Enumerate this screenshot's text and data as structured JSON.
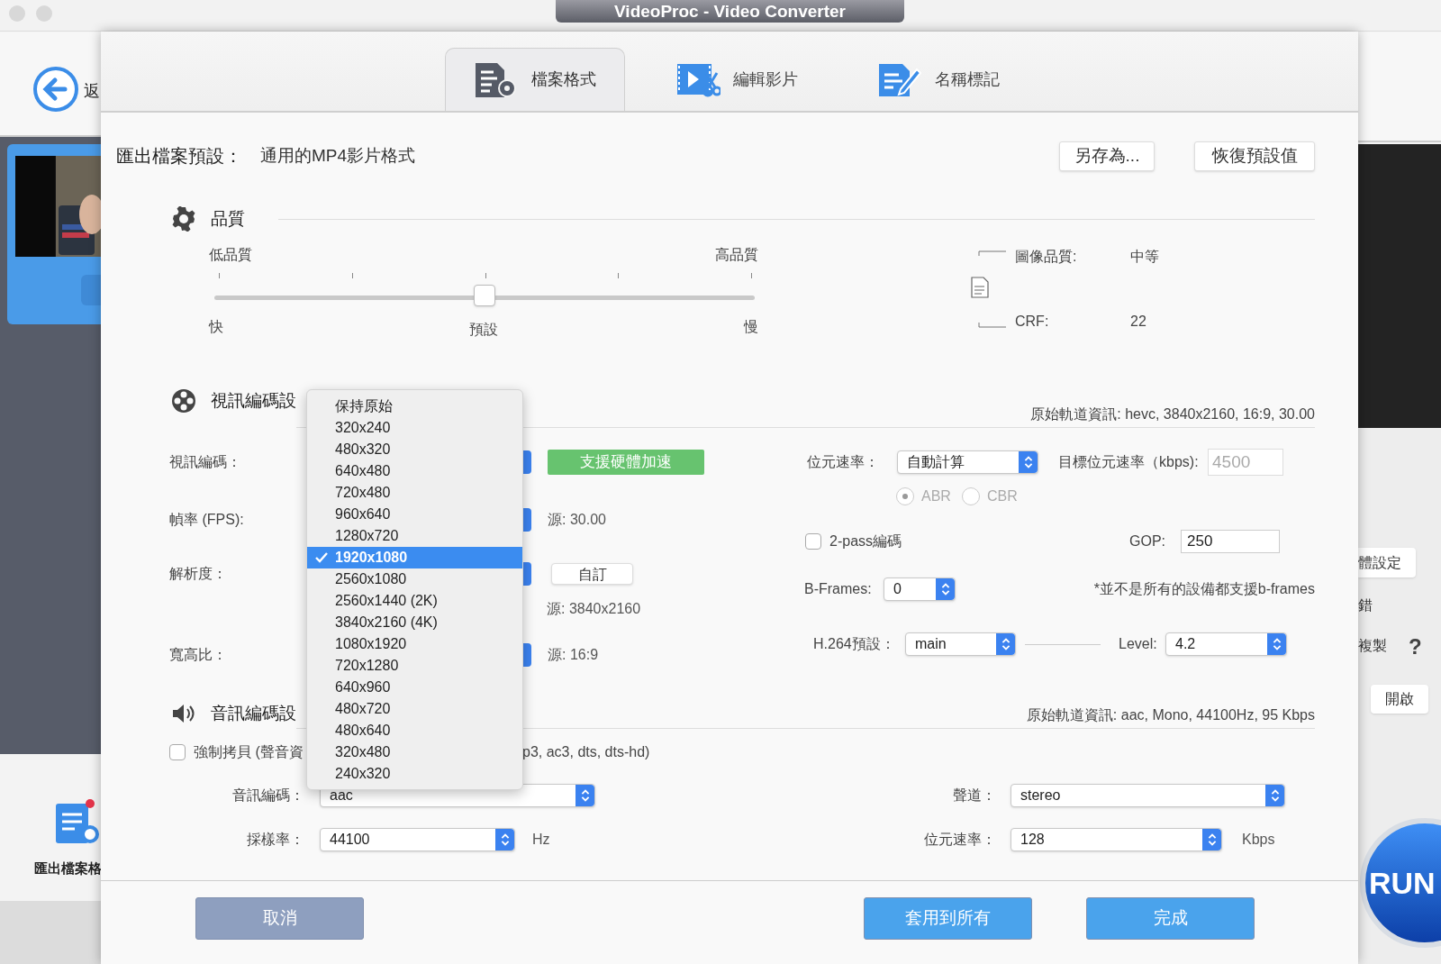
{
  "window": {
    "title": "VideoProc - Video Converter"
  },
  "background_app": {
    "back_label": "返",
    "export_label": "匯出檔案格",
    "right_items": [
      "體設定",
      "錯",
      "複製"
    ],
    "help": "?",
    "open_button": "開啟",
    "run_button": "RUN"
  },
  "tabs": [
    {
      "label": "檔案格式",
      "selected": true,
      "kind": "format"
    },
    {
      "label": "編輯影片",
      "selected": false,
      "kind": "edit"
    },
    {
      "label": "名稱標記",
      "selected": false,
      "kind": "tag"
    }
  ],
  "preset": {
    "label": "匯出檔案預設：",
    "value": "通用的MP4影片格式",
    "buttons": [
      "另存為...",
      "恢復預設值"
    ]
  },
  "quality": {
    "title": "品質",
    "low_label": "低品質",
    "high_label": "高品質",
    "fast_label": "快",
    "default_label": "預設",
    "slow_label": "慢",
    "level": 0.5,
    "image_quality_label": "圖像品質:",
    "image_quality_value": "中等",
    "crf_label": "CRF:",
    "crf_value": "22"
  },
  "video": {
    "title": "視訊編碼設",
    "source_info": "原始軌道資訊: hevc, 3840x2160, 16:9, 30.00",
    "codec_label": "視訊編碼：",
    "hw_badge": "支援硬體加速",
    "fps_label": "幀率 (FPS):",
    "fps_source": "源: 30.00",
    "resolution_label": "解析度：",
    "custom_button": "自訂",
    "resolution_source": "源: 3840x2160",
    "aspect_label": "寬高比：",
    "aspect_source": "源: 16:9",
    "bitrate_label": "位元速率：",
    "bitrate_mode": "自動計算",
    "target_label": "目標位元速率（kbps):",
    "target_value": "4500",
    "target_disabled": true,
    "rate_modes": [
      {
        "label": "ABR",
        "selected": true
      },
      {
        "label": "CBR",
        "selected": false
      }
    ],
    "rate_modes_disabled": true,
    "two_pass": {
      "label": "2-pass編碼",
      "checked": false
    },
    "gop_label": "GOP:",
    "gop_value": "250",
    "bframes_label": "B-Frames:",
    "bframes_value": "0",
    "bframes_note": "*並不是所有的設備都支援b-frames",
    "h264_label": "H.264預設：",
    "h264_value": "main",
    "level_label": "Level:",
    "level_value": "4.2"
  },
  "audio": {
    "title": "音訊編碼設",
    "source_info": "原始軌道資訊: aac, Mono, 44100Hz, 95 Kbps",
    "force_copy": {
      "label": "強制拷貝 (聲音資",
      "checked": false
    },
    "force_copy_tail": "p3, ac3, dts, dts-hd)",
    "codec_label": "音訊編碼：",
    "codec_value": "aac",
    "sample_label": "採樣率：",
    "sample_value": "44100",
    "sample_unit": "Hz",
    "channel_label": "聲道：",
    "channel_value": "stereo",
    "bitrate_label": "位元速率：",
    "bitrate_value": "128",
    "bitrate_unit": "Kbps"
  },
  "resolution_menu": {
    "items": [
      {
        "label": "保持原始",
        "selected": false
      },
      {
        "label": "320x240",
        "selected": false
      },
      {
        "label": "480x320",
        "selected": false
      },
      {
        "label": "640x480",
        "selected": false
      },
      {
        "label": "720x480",
        "selected": false
      },
      {
        "label": "960x640",
        "selected": false
      },
      {
        "label": "1280x720",
        "selected": false
      },
      {
        "label": "1920x1080",
        "selected": true
      },
      {
        "label": "2560x1080",
        "selected": false
      },
      {
        "label": "2560x1440 (2K)",
        "selected": false
      },
      {
        "label": "3840x2160 (4K)",
        "selected": false
      },
      {
        "label": "1080x1920",
        "selected": false
      },
      {
        "label": "720x1280",
        "selected": false
      },
      {
        "label": "640x960",
        "selected": false
      },
      {
        "label": "480x720",
        "selected": false
      },
      {
        "label": "480x640",
        "selected": false
      },
      {
        "label": "320x480",
        "selected": false
      },
      {
        "label": "240x320",
        "selected": false
      }
    ]
  },
  "footer": {
    "buttons": [
      {
        "label": "取消",
        "kind": "secondary"
      },
      {
        "label": "套用到所有",
        "kind": "primary"
      },
      {
        "label": "完成",
        "kind": "primary"
      }
    ]
  }
}
